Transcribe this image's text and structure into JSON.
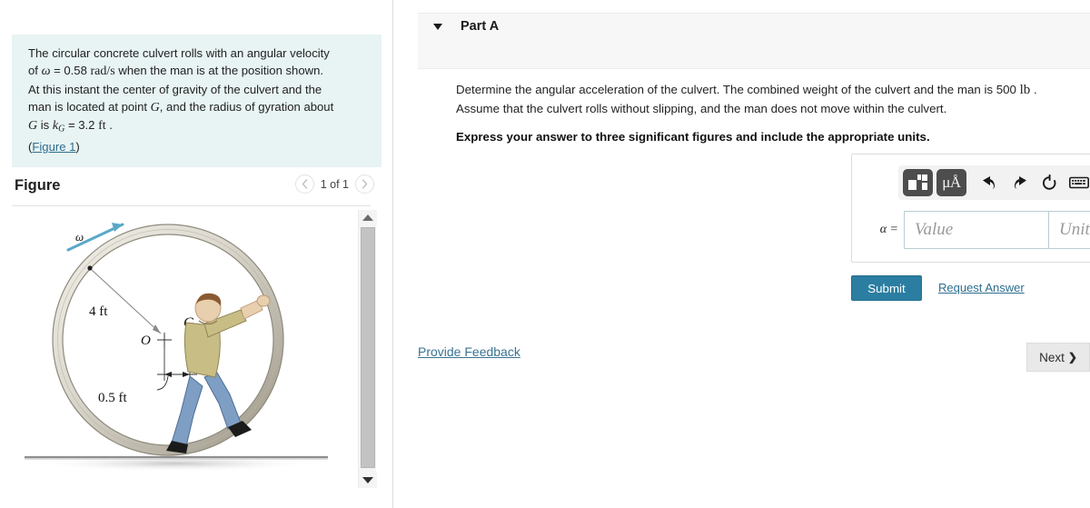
{
  "problem": {
    "line1_a": "The circular concrete culvert rolls with an angular velocity",
    "line2_a": "of ",
    "omega": "ω",
    "line2_b": " = 0.58 ",
    "rad_s": "rad/s",
    "line2_c": " when the man is at the position shown.",
    "line3": "At this instant the center of gravity of the culvert and the",
    "line4_a": "man is located at point ",
    "point_G": "G",
    "line4_b": ", and the radius of gyration about",
    "line5_a": "G",
    "line5_b": " is ",
    "kG_k": "k",
    "kG_sub": "G",
    "line5_c": " = 3.2 ",
    "ft": "ft",
    "line5_d": " .",
    "figure_link": "Figure 1",
    "paren_open": "(",
    "paren_close": ")"
  },
  "figure": {
    "title": "Figure",
    "counter": "1 of 1",
    "prev_icon": "chevron-left-icon",
    "next_icon": "chevron-right-icon",
    "labels": {
      "omega": "ω",
      "radius": "4 ft",
      "origin": "O",
      "center_gravity": "G",
      "offset": "0.5 ft"
    },
    "colors": {
      "omega_arrow": "#5aa8c9",
      "culvert_outer": "#9b9688",
      "culvert_fill": "#d9d6cd",
      "shirt": "#c9bd86",
      "jeans": "#7e9ec4",
      "hair": "#8a5a32",
      "skin": "#e8cfae",
      "shoes": "#1b1b1b",
      "ground": "#9c9c9c"
    }
  },
  "scrollbar": {
    "up_icon": "triangle-up-icon",
    "down_icon": "triangle-down-icon"
  },
  "part": {
    "title": "Part A",
    "caret_icon": "caret-down-icon"
  },
  "question": {
    "line1_a": "Determine the angular acceleration of the culvert. The combined weight of the culvert and the man is 500 ",
    "lb": "lb",
    "line1_b": " .",
    "line2": "Assume that the culvert rolls without slipping, and the man does not move within the culvert.",
    "bold_instruction": "Express your answer to three significant figures and include the appropriate units."
  },
  "answer": {
    "toolbar": {
      "template_icon": "math-template-icon",
      "units_icon": "micro-angstrom-units-icon",
      "units_label": "μÅ",
      "undo_icon": "undo-arrow-icon",
      "redo_icon": "redo-arrow-icon",
      "reset_icon": "reset-circular-arrow-icon",
      "keyboard_icon": "keyboard-icon",
      "help_icon": "question-mark-icon",
      "help_label": "?"
    },
    "variable_label": "α =",
    "value_placeholder": "Value",
    "units_placeholder": "Units",
    "value": "",
    "units": ""
  },
  "actions": {
    "submit_label": "Submit",
    "request_answer_label": "Request Answer",
    "provide_feedback_label": "Provide Feedback",
    "next_label": "Next",
    "next_chevron": "❯"
  },
  "colors": {
    "problem_bg": "#e8f3f3",
    "link": "#2d6e8e",
    "submit_bg": "#2b7ea1",
    "header_bg": "#f7f7f7"
  }
}
